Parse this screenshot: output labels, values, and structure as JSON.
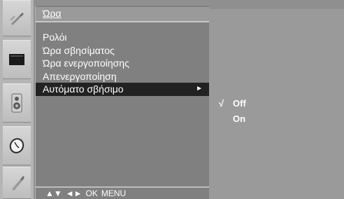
{
  "menu": {
    "title": "Ώρα",
    "items": [
      {
        "label": "Ρολόι"
      },
      {
        "label": "Ώρα σβησίματος"
      },
      {
        "label": "Ώρα ενεργοποίησης"
      },
      {
        "label": "Απενεργοποίηση"
      },
      {
        "label": "Αυτόματο σβήσιμο",
        "selected": true,
        "arrow": "►"
      }
    ]
  },
  "footer": {
    "nav_updown": "▲▼",
    "nav_leftright": "◄►",
    "ok": "OK",
    "menu": "MENU"
  },
  "submenu": {
    "check_mark": "√",
    "options": [
      {
        "label": "Off",
        "checked": true
      },
      {
        "label": "On",
        "checked": false
      }
    ]
  },
  "icons": [
    "picture-adjust-icon",
    "screen-icon",
    "audio-speaker-icon",
    "clock-icon",
    "options-icon"
  ],
  "colors": {
    "panel_bg": "#808080",
    "submenu_bg": "#9a9a9a",
    "highlight": "#222222",
    "text": "#ffffff"
  }
}
